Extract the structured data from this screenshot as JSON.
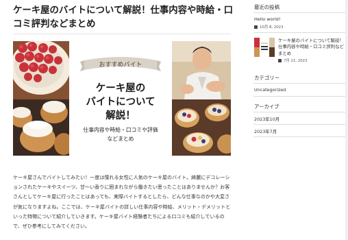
{
  "post": {
    "title": "ケーキ屋のバイトについて解説！仕事内容や時給・口コミ評判などまとめ",
    "hero": {
      "badge": "おすすめバイト",
      "headline_line1": "ケーキ屋の",
      "headline_line2": "バイトについて",
      "headline_line3": "解説！",
      "subtitle_line1": "仕事内容や時給・口コミや評価",
      "subtitle_line2": "などまとめ"
    },
    "body": "ケーキ屋さんでバイトしてみたい！一度は憧れる女性に人気のケーキ屋のバイト。綺麗にデコレーションされたケーキやスイーツ、甘～い香りに囲まれながら働きたい思ったことはありませんか？お客さんとしてケーキ屋に行ったことはあっても、実際バイトするとしたら、どんな仕事なのかや大変さが気になりますよね。ここでは、ケーキ屋バイトの詳しい仕事内容や時給、メリット・デメリットといった特徴について紹介していきます。ケーキ屋バイト経験者たちによる口コミも紹介しているので、ぜひ参考にしてみてください。"
  },
  "sidebar": {
    "recent_heading": "最近の投稿",
    "recent_items": [
      {
        "title": "Hello world!",
        "date": "10月 8, 2023"
      },
      {
        "title": "ケーキ屋のバイトについて解説！仕事内容や時給・口コミ評判などまとめ",
        "date": "7月 21, 2023"
      }
    ],
    "category_heading": "カテゴリー",
    "categories": [
      "Uncategorized"
    ],
    "archive_heading": "アーカイブ",
    "archives": [
      "2023年10月",
      "2023年7月"
    ]
  },
  "colors": {
    "hero_banner_bg": "#ffffff",
    "badge_bg": "#d9d2c6",
    "headline_text": "#1a1a1a",
    "cake_red": "#c8323a"
  }
}
